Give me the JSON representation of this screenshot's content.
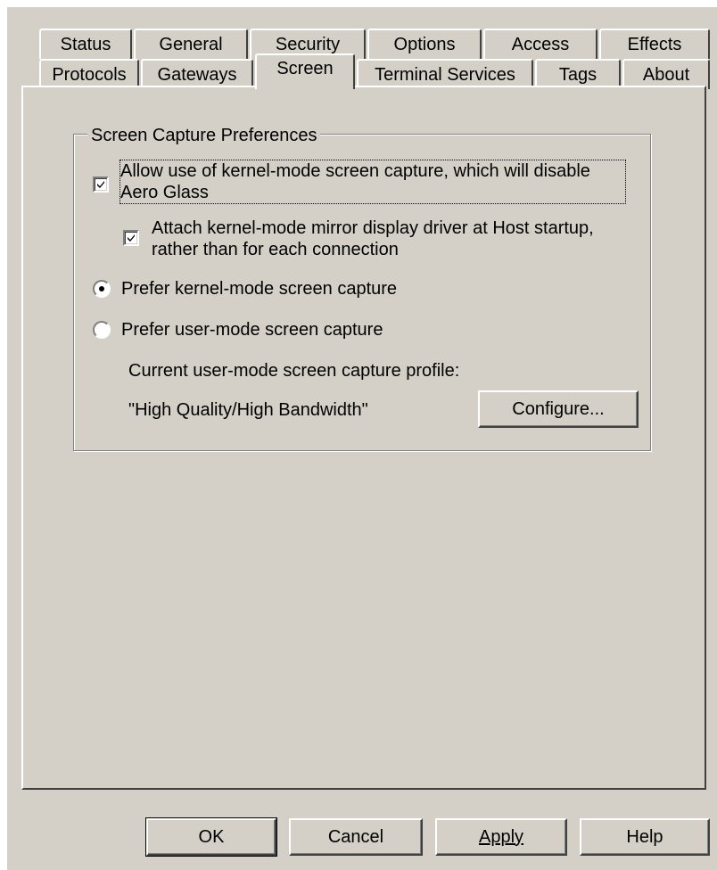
{
  "tabs_row1": [
    {
      "label": "Status"
    },
    {
      "label": "General"
    },
    {
      "label": "Security"
    },
    {
      "label": "Options"
    },
    {
      "label": "Access"
    },
    {
      "label": "Effects"
    }
  ],
  "tabs_row2": [
    {
      "label": "Protocols"
    },
    {
      "label": "Gateways"
    },
    {
      "label": "Screen"
    },
    {
      "label": "Terminal Services"
    },
    {
      "label": "Tags"
    },
    {
      "label": "About"
    }
  ],
  "active_tab": "Screen",
  "group": {
    "legend": "Screen Capture Preferences",
    "kernel_capture": {
      "line1": "Allow use of kernel-mode screen capture, which will disable",
      "line2": "Aero Glass",
      "checked": true
    },
    "attach_driver": {
      "line1": "Attach kernel-mode mirror display driver at Host startup,",
      "line2": "rather than for each connection",
      "checked": true
    },
    "prefer_kernel": {
      "label": "Prefer kernel-mode screen capture",
      "selected": true
    },
    "prefer_user": {
      "label": "Prefer user-mode screen capture",
      "selected": false
    },
    "profile_caption": "Current user-mode screen capture profile:",
    "profile_value": "\"High Quality/High Bandwidth\"",
    "configure_label": "Configure..."
  },
  "buttons": {
    "ok": "OK",
    "cancel": "Cancel",
    "apply": "Apply",
    "help": "Help"
  }
}
